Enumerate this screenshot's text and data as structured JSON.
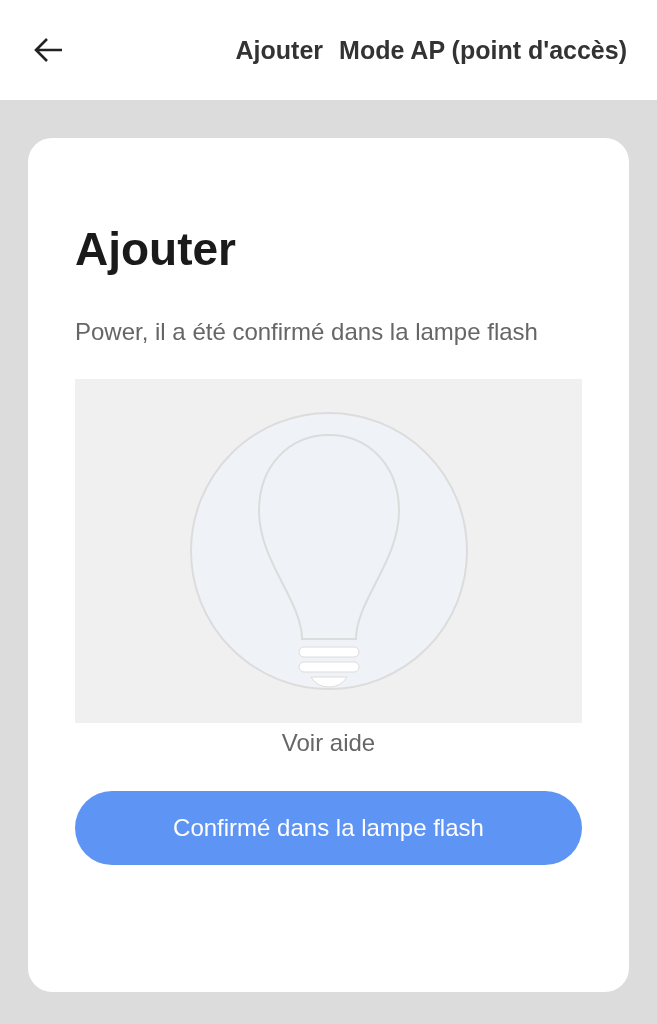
{
  "header": {
    "title_parts": [
      "Ajouter",
      "Mode AP (point d'accès)"
    ]
  },
  "card": {
    "heading": "Ajouter",
    "description": "Power, il a été confirmé dans la lampe flash",
    "help_link": "Voir aide",
    "confirm_button": "Confirmé dans la lampe flash"
  }
}
